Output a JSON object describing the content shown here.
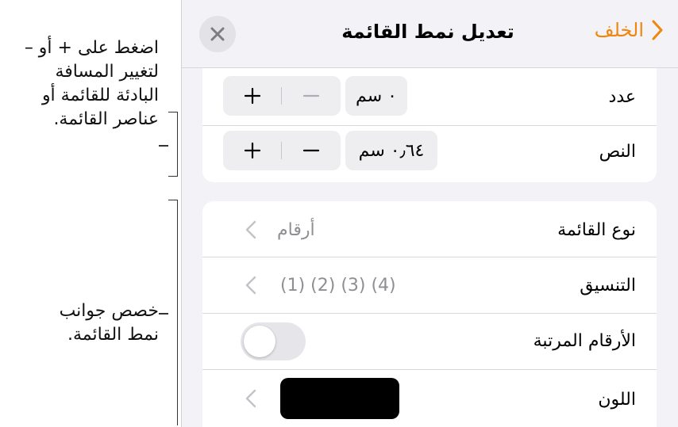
{
  "callouts": {
    "top": [
      "اضغط على + أو –",
      "لتغيير المسافة",
      "البادئة للقائمة أو",
      "عناصر القائمة."
    ],
    "bottom": [
      "خصص جوانب",
      "نمط القائمة."
    ]
  },
  "navbar": {
    "title": "تعديل نمط القائمة",
    "back_label": "الخلف",
    "close_icon": "close-icon",
    "back_icon": "chevron-right-icon"
  },
  "indent": {
    "rows": [
      {
        "label": "عدد",
        "value": "٠ سم",
        "plus": "+",
        "minus": "–"
      },
      {
        "label": "النص",
        "value": "٠٫٦٤ سم",
        "plus": "+",
        "minus": "–"
      }
    ]
  },
  "style": {
    "list_type": {
      "label": "نوع القائمة",
      "value": "أرقام"
    },
    "format": {
      "label": "التنسيق",
      "value": "(1) (2) (3) (4)"
    },
    "tiered": {
      "label": "الأرقام المرتبة",
      "on": false
    },
    "color": {
      "label": "اللون",
      "value": "#000000"
    }
  },
  "colors": {
    "accent": "#f0860c",
    "panel_bg": "#f2f2f7"
  }
}
